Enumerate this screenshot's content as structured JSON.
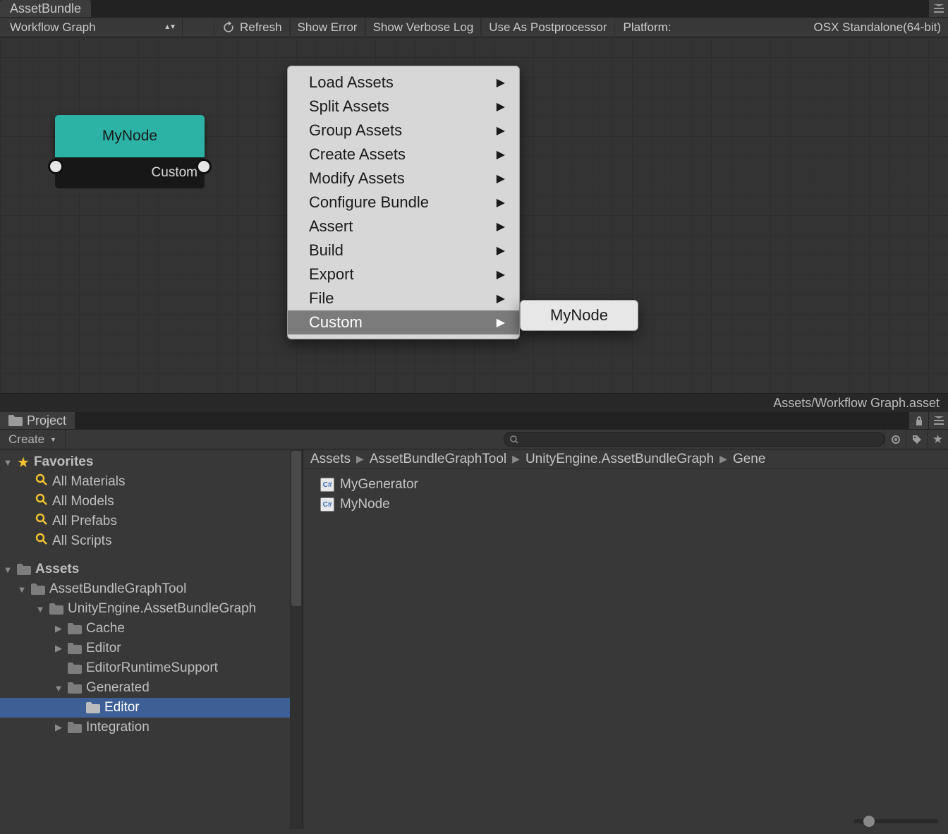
{
  "tab_title": "AssetBundle",
  "toolbar": {
    "graph_dropdown": "Workflow Graph",
    "refresh": "Refresh",
    "show_error": "Show Error",
    "show_verbose": "Show Verbose Log",
    "use_postprocessor": "Use As Postprocessor",
    "platform_label": "Platform:",
    "platform_value": "OSX Standalone(64-bit)"
  },
  "node": {
    "title": "MyNode",
    "type": "Custom"
  },
  "context_menu": {
    "items": [
      {
        "label": "Load Assets",
        "submenu": true
      },
      {
        "label": "Split Assets",
        "submenu": true
      },
      {
        "label": "Group Assets",
        "submenu": true
      },
      {
        "label": "Create Assets",
        "submenu": true
      },
      {
        "label": "Modify Assets",
        "submenu": true
      },
      {
        "label": "Configure Bundle",
        "submenu": true
      },
      {
        "label": "Assert",
        "submenu": true
      },
      {
        "label": "Build",
        "submenu": true
      },
      {
        "label": "Export",
        "submenu": true
      },
      {
        "label": "File",
        "submenu": true
      },
      {
        "label": "Custom",
        "submenu": true,
        "selected": true
      }
    ],
    "submenu_item": "MyNode"
  },
  "asset_path": "Assets/Workflow Graph.asset",
  "project": {
    "tab": "Project",
    "create": "Create",
    "breadcrumb": [
      "Assets",
      "AssetBundleGraphTool",
      "UnityEngine.AssetBundleGraph",
      "Gene"
    ],
    "favorites_label": "Favorites",
    "favorites": [
      "All Materials",
      "All Models",
      "All Prefabs",
      "All Scripts"
    ],
    "assets_label": "Assets",
    "tree": [
      {
        "label": "AssetBundleGraphTool",
        "level": 3,
        "expanded": true
      },
      {
        "label": "UnityEngine.AssetBundleGraph",
        "level": 4,
        "expanded": true
      },
      {
        "label": "Cache",
        "level": 5,
        "expanded": false,
        "twisty": true
      },
      {
        "label": "Editor",
        "level": 5,
        "expanded": false,
        "twisty": true
      },
      {
        "label": "EditorRuntimeSupport",
        "level": 5,
        "expanded": false,
        "twisty": false
      },
      {
        "label": "Generated",
        "level": 5,
        "expanded": true,
        "twisty": true
      },
      {
        "label": "Editor",
        "level": 6,
        "expanded": false,
        "twisty": false,
        "selected": true
      },
      {
        "label": "Integration",
        "level": 5,
        "expanded": false,
        "twisty": true
      }
    ],
    "files": [
      "MyGenerator",
      "MyNode"
    ]
  }
}
